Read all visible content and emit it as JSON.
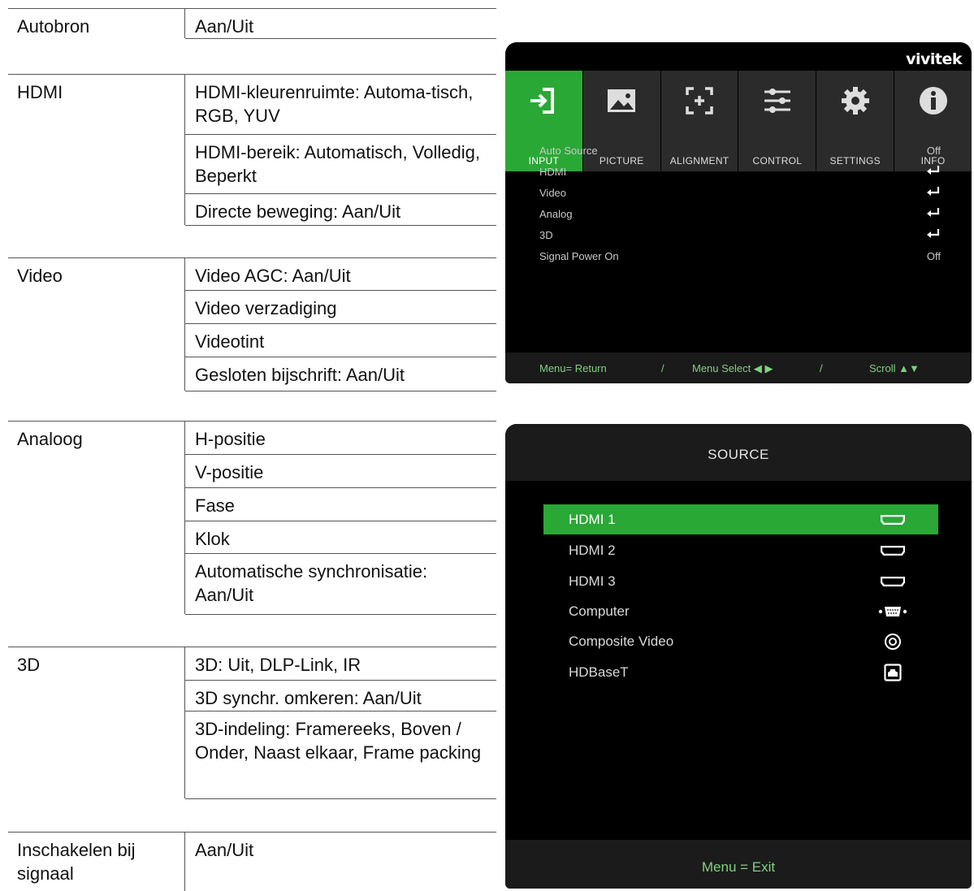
{
  "tables": [
    {
      "key": "Autobron",
      "values": [
        "Aan/Uit"
      ]
    },
    {
      "key": "HDMI",
      "values": [
        "HDMI-kleurenruimte: Automa-tisch, RGB, YUV",
        "HDMI-bereik: Automatisch, Volledig, Beperkt",
        "Directe beweging: Aan/Uit"
      ]
    },
    {
      "key": "Video",
      "values": [
        "Video AGC: Aan/Uit",
        "Video verzadiging",
        "Videotint",
        "Gesloten bijschrift: Aan/Uit"
      ]
    },
    {
      "key": "Analoog",
      "values": [
        "H-positie",
        "V-positie",
        "Fase",
        "Klok",
        "Automatische synchronisatie: Aan/Uit"
      ]
    },
    {
      "key": "3D",
      "values": [
        "3D: Uit, DLP-Link, IR",
        "3D synchr. omkeren: Aan/Uit",
        "3D-indeling: Framereeks, Boven / Onder, Naast elkaar, Frame packing"
      ]
    },
    {
      "key": "Inschakelen bij signaal",
      "values": [
        "Aan/Uit"
      ]
    }
  ],
  "osd_input": {
    "brand": "vivitek",
    "tabs": [
      {
        "label": "INPUT",
        "icon": "input-icon",
        "active": true
      },
      {
        "label": "PICTURE",
        "icon": "picture-icon",
        "active": false
      },
      {
        "label": "ALIGNMENT",
        "icon": "alignment-icon",
        "active": false
      },
      {
        "label": "CONTROL",
        "icon": "control-icon",
        "active": false
      },
      {
        "label": "SETTINGS",
        "icon": "settings-icon",
        "active": false
      },
      {
        "label": "INFO",
        "icon": "info-icon",
        "active": false
      }
    ],
    "items": [
      {
        "label": "Auto Source",
        "value": "Off"
      },
      {
        "label": "HDMI",
        "value": ""
      },
      {
        "label": "Video",
        "value": ""
      },
      {
        "label": "Analog",
        "value": ""
      },
      {
        "label": "3D",
        "value": ""
      },
      {
        "label": "Signal Power On",
        "value": "Off"
      }
    ],
    "footer": {
      "return": "Menu= Return",
      "sep1": "/",
      "select": "Menu Select ◀ ▶",
      "sep2": "/",
      "scroll": "Scroll ▲▼"
    },
    "accent": "#2aa836"
  },
  "osd_source": {
    "title": "SOURCE",
    "items": [
      {
        "label": "HDMI 1",
        "icon": "hdmi-icon",
        "selected": true
      },
      {
        "label": "HDMI 2",
        "icon": "hdmi-icon",
        "selected": false
      },
      {
        "label": "HDMI 3",
        "icon": "hdmi-icon",
        "selected": false
      },
      {
        "label": "Computer",
        "icon": "vga-icon",
        "selected": false
      },
      {
        "label": "Composite Video",
        "icon": "composite-icon",
        "selected": false
      },
      {
        "label": "HDBaseT",
        "icon": "hdbaset-icon",
        "selected": false
      }
    ],
    "footer": "Menu = Exit"
  }
}
